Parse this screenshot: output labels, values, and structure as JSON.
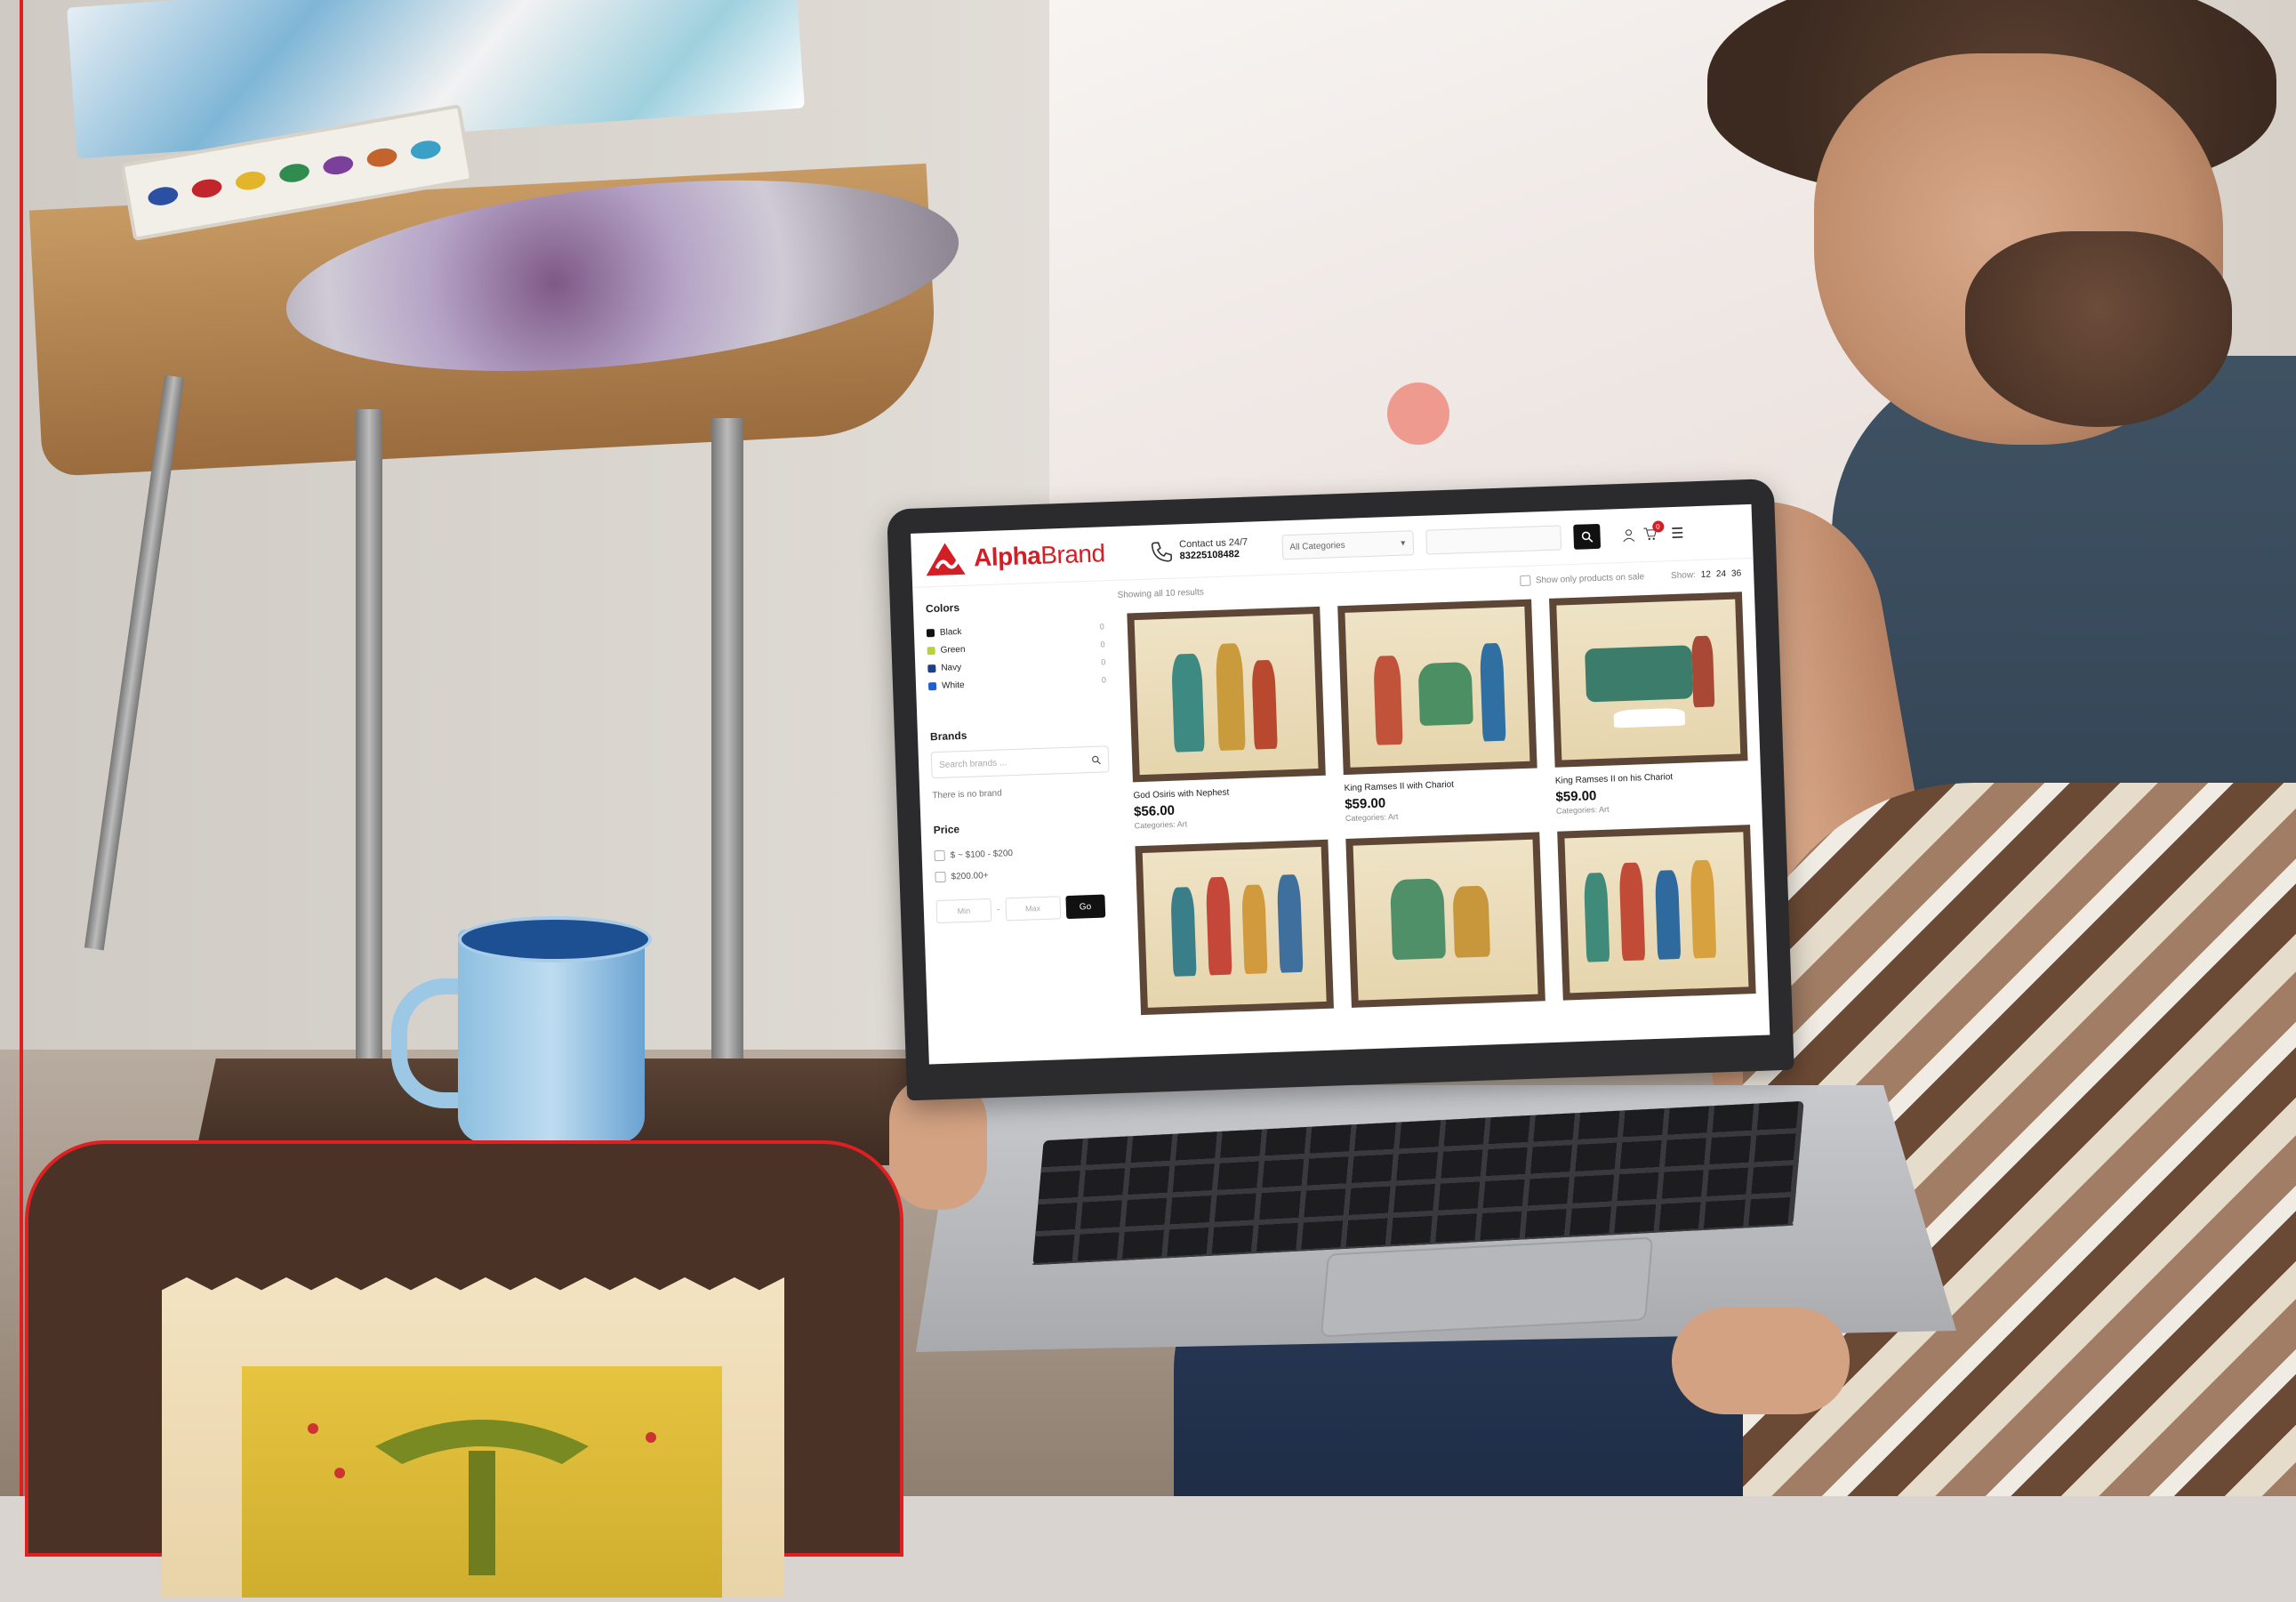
{
  "site": {
    "brand_bold": "Alpha",
    "brand_light": "Brand",
    "contact_title": "Contact us 24/7",
    "contact_number": "83225108482",
    "category_select": "All Categories",
    "cart_count": "0"
  },
  "sidebar": {
    "colors_heading": "Colors",
    "colors": [
      {
        "label": "Black",
        "swatch": "#111111",
        "count": "0"
      },
      {
        "label": "Green",
        "swatch": "#b9d13a",
        "count": "0"
      },
      {
        "label": "Navy",
        "swatch": "#1f3e8c",
        "count": "0"
      },
      {
        "label": "White",
        "swatch": "#1f5fd1",
        "count": "0"
      }
    ],
    "brands_heading": "Brands",
    "brand_search_placeholder": "Search brands ...",
    "no_brand_note": "There is no brand",
    "price_heading": "Price",
    "price_options": [
      "$ ~ $100 - $200",
      "$200.00+"
    ],
    "min_placeholder": "Min",
    "max_placeholder": "Max",
    "go_label": "Go"
  },
  "toolbar": {
    "result_count": "Showing all 10 results",
    "on_sale_label": "Show only products on sale",
    "show_label": "Show:",
    "per_page": [
      "12",
      "24",
      "36"
    ]
  },
  "products": [
    {
      "name": "God Osiris with Nephest",
      "price": "$56.00",
      "category": "Categories: Art"
    },
    {
      "name": "King Ramses II with Chariot",
      "price": "$59.00",
      "category": "Categories: Art"
    },
    {
      "name": "King Ramses II on his Chariot",
      "price": "$59.00",
      "category": "Categories: Art"
    },
    {
      "name": "",
      "price": "",
      "category": ""
    },
    {
      "name": "",
      "price": "",
      "category": ""
    },
    {
      "name": "",
      "price": "",
      "category": ""
    }
  ],
  "colors": {
    "brand_red": "#d21f26",
    "promo_border": "#e02020",
    "promo_bg": "#4a3226"
  }
}
